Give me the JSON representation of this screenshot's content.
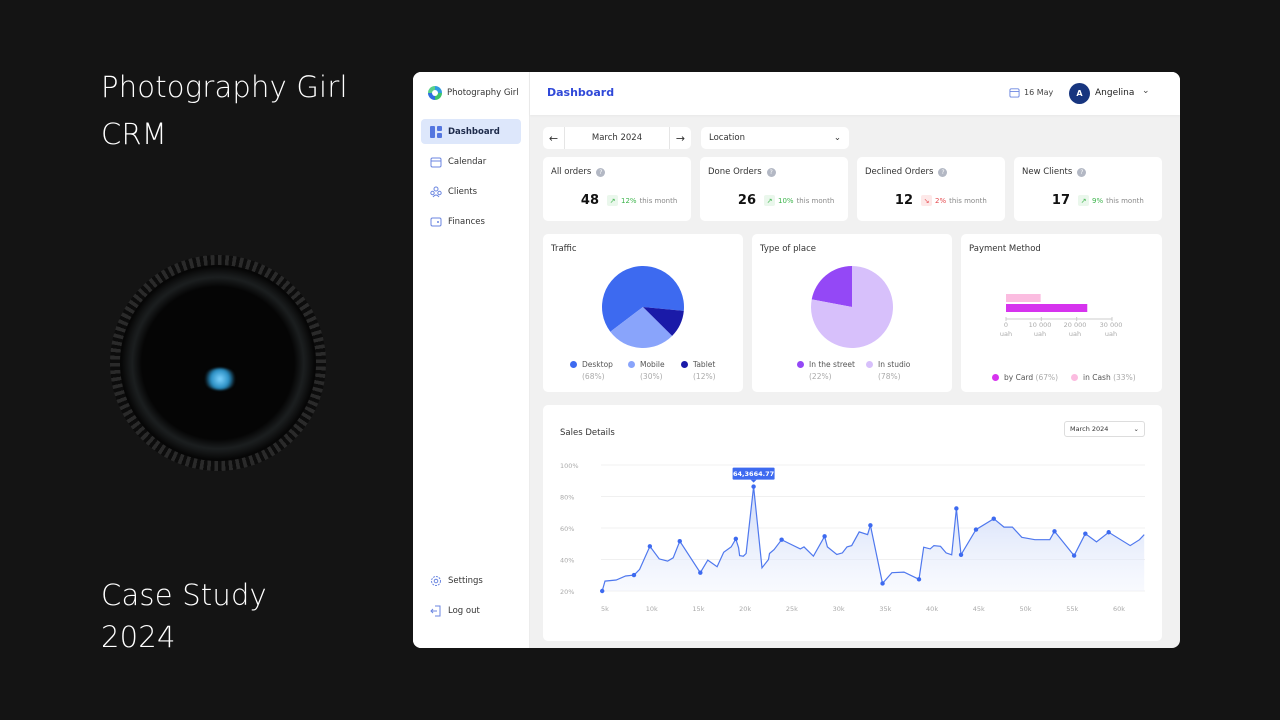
{
  "hero": {
    "title_line1": "Photography Girl",
    "title_line2": "CRM",
    "footer_line1": "Case Study",
    "footer_line2": "2024"
  },
  "app": {
    "name": "Photography Girl"
  },
  "sidebar": {
    "items": [
      {
        "label": "Dashboard",
        "icon": "dashboard-icon",
        "active": true
      },
      {
        "label": "Calendar",
        "icon": "calendar-icon"
      },
      {
        "label": "Clients",
        "icon": "clients-icon"
      },
      {
        "label": "Finances",
        "icon": "wallet-icon"
      }
    ],
    "bottom": [
      {
        "label": "Settings",
        "icon": "gear-icon"
      },
      {
        "label": "Log out",
        "icon": "logout-icon"
      }
    ]
  },
  "header": {
    "title": "Dashboard",
    "date": "16 May",
    "user": {
      "initial": "A",
      "name": "Angelina"
    }
  },
  "filters": {
    "month": "March 2024",
    "location_placeholder": "Location"
  },
  "stats": [
    {
      "title": "All orders",
      "value": "48",
      "delta": "12%",
      "suffix": "this month",
      "trend": "up"
    },
    {
      "title": "Done Orders",
      "value": "26",
      "delta": "10%",
      "suffix": "this month",
      "trend": "up"
    },
    {
      "title": "Declined Orders",
      "value": "12",
      "delta": "2%",
      "suffix": "this month",
      "trend": "down"
    },
    {
      "title": "New Clients",
      "value": "17",
      "delta": "9%",
      "suffix": "this month",
      "trend": "up"
    }
  ],
  "colors": {
    "accent": "#2f48d8",
    "up": "#3cb44b",
    "down": "#e5484d"
  },
  "chart_data": [
    {
      "type": "pie",
      "title": "Traffic",
      "slices": [
        {
          "name": "Desktop",
          "label": "(68%)",
          "value": 68,
          "color": "#3d6af0"
        },
        {
          "name": "Mobile",
          "label": "(30%)",
          "value": 30,
          "color": "#89a4fb"
        },
        {
          "name": "Tablet",
          "label": "(12%)",
          "value": 12,
          "color": "#1a1aa8"
        }
      ]
    },
    {
      "type": "pie",
      "title": "Type of place",
      "slices": [
        {
          "name": "In the street",
          "label": "(22%)",
          "value": 22,
          "color": "#9448f6"
        },
        {
          "name": "In studio",
          "label": "(78%)",
          "value": 78,
          "color": "#d7c0fb"
        }
      ]
    },
    {
      "type": "bar",
      "orientation": "horizontal",
      "title": "Payment Method",
      "series": [
        {
          "name": "in Cash",
          "label": "(33%)",
          "value": 9800,
          "color": "#fbbce0"
        },
        {
          "name": "by Card",
          "label": "(67%)",
          "value": 23000,
          "color": "#d633ee"
        }
      ],
      "xticks": [
        {
          "value": 0,
          "label": "0",
          "unit": "uah"
        },
        {
          "value": 10000,
          "label": "10 000",
          "unit": "uah"
        },
        {
          "value": 20000,
          "label": "20 000",
          "unit": "uah"
        },
        {
          "value": 30000,
          "label": "30 000",
          "unit": "uah"
        }
      ],
      "xlim": [
        0,
        30000
      ]
    },
    {
      "type": "area",
      "title": "Sales Details",
      "period": "March 2024",
      "xlim": [
        4.7,
        62.7
      ],
      "ylim": [
        20,
        100
      ],
      "xticks": [
        "5k",
        "10k",
        "15k",
        "20k",
        "25k",
        "30k",
        "35k",
        "40k",
        "45k",
        "50k",
        "55k",
        "60k"
      ],
      "yticks": [
        "100%",
        "80%",
        "60%",
        "40%",
        "20%"
      ],
      "grid": true,
      "tooltip": {
        "x": 20.9,
        "label": "64,3664.77"
      },
      "x": [
        4.7,
        5.0,
        6.2,
        7.2,
        8.1,
        8.7,
        9.8,
        10.8,
        11.7,
        12.3,
        13.0,
        15.2,
        16.0,
        17.0,
        17.7,
        18.5,
        19.0,
        19.3,
        19.4,
        19.8,
        20.1,
        20.9,
        21.8,
        22.5,
        22.6,
        23.1,
        23.9,
        24.8,
        25.9,
        26.3,
        27.3,
        28.5,
        28.8,
        29.8,
        30.4,
        30.9,
        31.4,
        32.2,
        33.1,
        33.4,
        34.7,
        35.7,
        37.0,
        38.6,
        39.1,
        39.8,
        40.2,
        40.9,
        41.5,
        42.1,
        42.6,
        43.1,
        44.7,
        46.6,
        47.7,
        48.6,
        49.6,
        51.0,
        52.6,
        53.1,
        55.2,
        56.4,
        57.6,
        58.9,
        61.2,
        62.2,
        62.7
      ],
      "y": [
        20.0,
        26.3,
        27.0,
        29.5,
        30.1,
        33.7,
        48.4,
        40.4,
        39.0,
        41.1,
        51.6,
        31.6,
        39.6,
        35.4,
        44.6,
        48.0,
        53.1,
        47.4,
        42.5,
        42.1,
        43.8,
        86.3,
        34.7,
        40.0,
        43.8,
        46.3,
        52.6,
        49.9,
        46.7,
        48.0,
        42.1,
        54.7,
        48.0,
        43.2,
        44.2,
        48.0,
        48.8,
        57.5,
        55.8,
        61.7,
        24.8,
        31.6,
        32.0,
        27.4,
        47.8,
        46.7,
        48.8,
        48.4,
        44.2,
        43.0,
        72.4,
        43.0,
        59.0,
        65.9,
        60.6,
        60.6,
        54.1,
        52.6,
        52.6,
        57.9,
        42.5,
        56.4,
        51.2,
        57.3,
        48.8,
        52.6,
        55.8
      ],
      "markers_x": [
        4.7,
        8.1,
        9.8,
        13.0,
        15.2,
        19.0,
        20.9,
        23.9,
        28.5,
        33.4,
        34.7,
        38.6,
        42.6,
        43.1,
        44.7,
        46.6,
        53.1,
        55.2,
        56.4,
        58.9
      ]
    }
  ]
}
